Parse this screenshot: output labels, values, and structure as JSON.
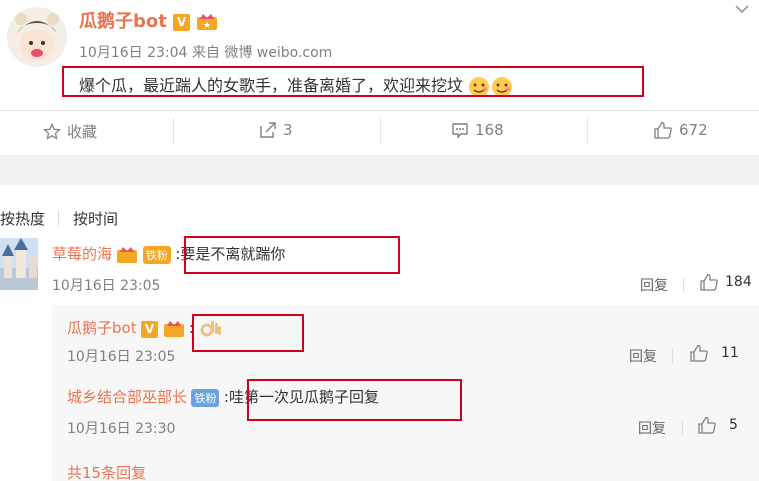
{
  "post": {
    "username": "瓜鹅子bot",
    "v_badge": "V",
    "meta": "10月16日 23:04 来自 微博 weibo.com",
    "text": "爆个瓜，最近踹人的女歌手，准备离婚了，欢迎来挖坟"
  },
  "actions": {
    "favorite_label": "收藏",
    "repost_count": "3",
    "comment_count": "168",
    "like_count": "672"
  },
  "sort": {
    "hot": "按热度",
    "time": "按时间"
  },
  "comment": {
    "name": "草莓的海",
    "fan_badge": "铁粉",
    "text": ":要是不离就踹你",
    "time": "10月16日 23:05",
    "reply_label": "回复",
    "likes": "184"
  },
  "replies": [
    {
      "name": "瓜鹅子bot",
      "v_badge": "V",
      "text": ":",
      "time": "10月16日 23:05",
      "reply_label": "回复",
      "likes": "11"
    },
    {
      "name": "城乡结合部巫部长",
      "fan_badge": "铁粉",
      "text": ":哇第一次见瓜鹅子回复",
      "time": "10月16日 23:30",
      "reply_label": "回复",
      "likes": "5"
    }
  ],
  "more_replies": "共15条回复",
  "colors": {
    "accent": "#eb7350",
    "highlight_box": "#d0021b",
    "badge_gold": "#f5a623",
    "badge_blue": "#6aa3e0"
  }
}
